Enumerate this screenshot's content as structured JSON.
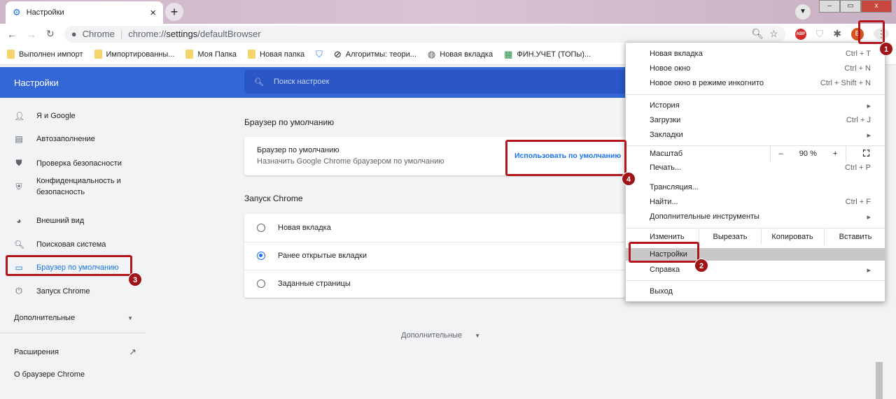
{
  "tab": {
    "title": "Настройки",
    "close": "×",
    "new_tab": "+"
  },
  "window": {
    "minimize": "–",
    "maximize": "▭",
    "close": "x"
  },
  "toolbar": {
    "site_label": "Chrome",
    "url_prefix": "chrome://",
    "url_bold": "settings",
    "url_suffix": "/defaultBrowser",
    "avatar_letter": "B",
    "abp": "ABP"
  },
  "bookmarks": [
    {
      "label": "Выполнен импорт",
      "icon": "folder"
    },
    {
      "label": "Импортированны...",
      "icon": "folder"
    },
    {
      "label": "Моя Папка",
      "icon": "folder"
    },
    {
      "label": "Новая папка",
      "icon": "folder"
    },
    {
      "label": "",
      "icon": "shield"
    },
    {
      "label": "Алгоритмы: теори...",
      "icon": "logo"
    },
    {
      "label": "Новая вкладка",
      "icon": "globe"
    },
    {
      "label": "ФИН.УЧЕТ (ТОПы)...",
      "icon": "sheets"
    }
  ],
  "header": {
    "title": "Настройки",
    "search_placeholder": "Поиск настроек"
  },
  "sidebar": {
    "items": [
      {
        "label": "Я и Google",
        "icon": "person"
      },
      {
        "label": "Автозаполнение",
        "icon": "clipboard"
      },
      {
        "label": "Проверка безопасности",
        "icon": "shield"
      },
      {
        "label": "Конфиденциальность и",
        "label2": "безопасность",
        "icon": "shield-lock"
      },
      {
        "label": "Внешний вид",
        "icon": "palette"
      },
      {
        "label": "Поисковая система",
        "icon": "search"
      },
      {
        "label": "Браузер по умолчанию",
        "icon": "browser",
        "active": true
      },
      {
        "label": "Запуск Chrome",
        "icon": "power"
      }
    ],
    "advanced": "Дополнительные",
    "extensions": "Расширения",
    "about": "О браузере Chrome"
  },
  "main": {
    "default_section": "Браузер по умолчанию",
    "default_title": "Браузер по умолчанию",
    "default_sub": "Назначить Google Chrome браузером по умолчанию",
    "default_button": "Использовать по умолчанию",
    "startup_section": "Запуск Chrome",
    "startup_options": [
      {
        "label": "Новая вкладка",
        "selected": false
      },
      {
        "label": "Ранее открытые вкладки",
        "selected": true
      },
      {
        "label": "Заданные страницы",
        "selected": false
      }
    ],
    "advanced": "Дополнительные"
  },
  "menu": {
    "items": [
      {
        "label": "Новая вкладка",
        "key": "Ctrl + T"
      },
      {
        "label": "Новое окно",
        "key": "Ctrl + N"
      },
      {
        "label": "Новое окно в режиме инкогнито",
        "key": "Ctrl + Shift + N"
      },
      {
        "label": "История",
        "key": "▸"
      },
      {
        "label": "Загрузки",
        "key": "Ctrl + J"
      },
      {
        "label": "Закладки",
        "key": "▸"
      },
      {
        "label": "Печать...",
        "key": "Ctrl + P"
      },
      {
        "label": "Трансляция...",
        "key": ""
      },
      {
        "label": "Найти...",
        "key": "Ctrl + F"
      },
      {
        "label": "Дополнительные инструменты",
        "key": "▸"
      },
      {
        "label": "Настройки",
        "key": ""
      },
      {
        "label": "Справка",
        "key": "▸"
      },
      {
        "label": "Выход",
        "key": ""
      }
    ],
    "zoom": {
      "label": "Масштаб",
      "minus": "–",
      "value": "90 %",
      "plus": "+"
    },
    "edit": {
      "label": "Изменить",
      "cut": "Вырезать",
      "copy": "Копировать",
      "paste": "Вставить"
    }
  },
  "annotations": [
    "1",
    "2",
    "3",
    "4"
  ],
  "colors": {
    "accent": "#1a73e8",
    "header": "#3367d6",
    "highlight": "#b0161b"
  }
}
